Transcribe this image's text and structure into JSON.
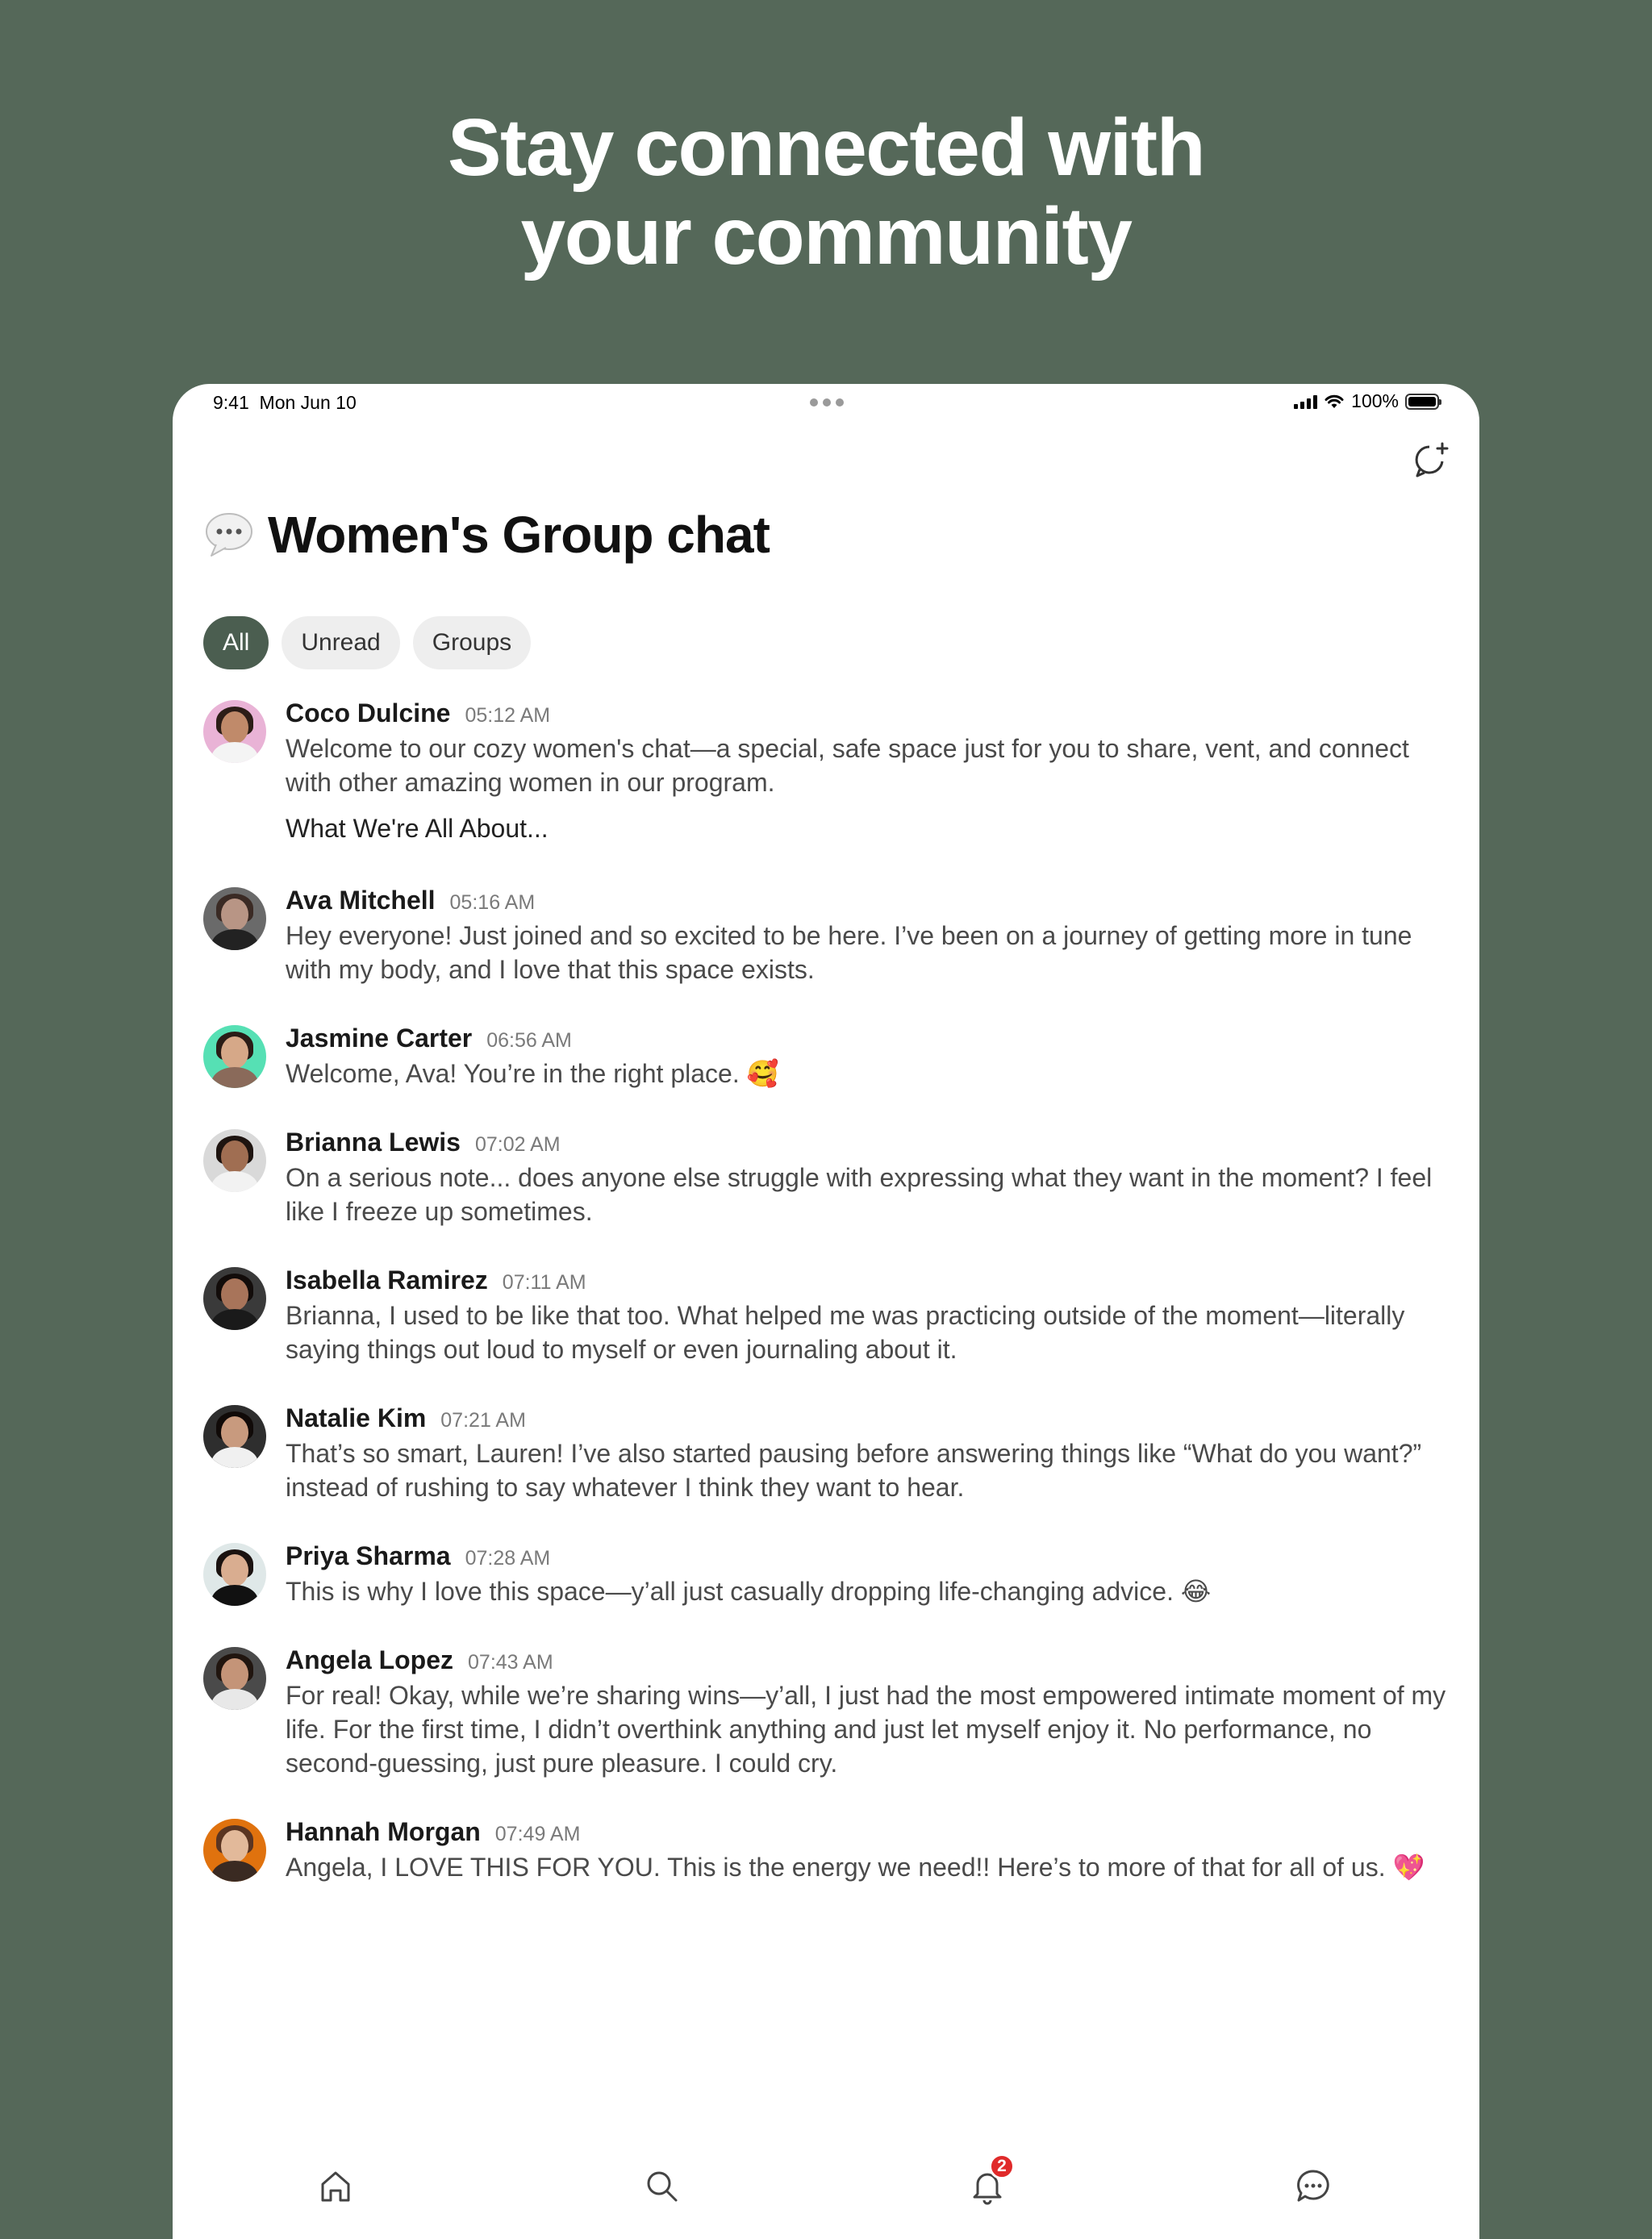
{
  "headline": {
    "line1": "Stay connected with",
    "line2": "your community"
  },
  "status_bar": {
    "time": "9:41",
    "date": "Mon Jun 10",
    "battery": "100%"
  },
  "page": {
    "title": "Women's Group chat",
    "title_icon": "speech-bubble-icon"
  },
  "filters": [
    {
      "label": "All",
      "active": true
    },
    {
      "label": "Unread",
      "active": false
    },
    {
      "label": "Groups",
      "active": false
    }
  ],
  "messages": [
    {
      "name": "Coco Dulcine",
      "time": "05:12 AM",
      "text": "Welcome to our cozy women's chat—a special, safe space just for you to share, vent, and connect with other amazing women in our program.",
      "subtext": "What We're All About..."
    },
    {
      "name": "Ava Mitchell",
      "time": "05:16 AM",
      "text": "Hey everyone! Just joined and so excited to be here. I’ve been on a journey of getting more in tune with my body, and I love that this space exists."
    },
    {
      "name": "Jasmine Carter",
      "time": "06:56 AM",
      "text": "Welcome, Ava! You’re in the right place. 🥰"
    },
    {
      "name": "Brianna Lewis",
      "time": "07:02 AM",
      "text": "On a serious note... does anyone else struggle with expressing what they want in the moment? I feel like I freeze up sometimes."
    },
    {
      "name": "Isabella Ramirez",
      "time": "07:11 AM",
      "text": "Brianna, I used to be like that too. What helped me was practicing outside of the moment—literally saying things out loud to myself or even journaling about it."
    },
    {
      "name": "Natalie Kim",
      "time": "07:21 AM",
      "text": "That’s so smart, Lauren! I’ve also started pausing before answering things like “What do you want?” instead of rushing to say whatever I think they want to hear."
    },
    {
      "name": "Priya Sharma",
      "time": "07:28 AM",
      "text": "This is why I love this space—y’all just casually dropping life-changing advice. 😂"
    },
    {
      "name": "Angela Lopez",
      "time": "07:43 AM",
      "text": "For real! Okay, while we’re sharing wins—y’all, I just had the most empowered intimate moment of my life. For the first time, I didn’t overthink anything and just let myself enjoy it. No performance, no second-guessing, just pure pleasure. I could cry."
    },
    {
      "name": "Hannah Morgan",
      "time": "07:49 AM",
      "text": "Angela, I LOVE THIS FOR YOU. This is the energy we need!! Here’s to more of that for all of us. 💖"
    }
  ],
  "tabbar": {
    "notifications_badge": "2"
  },
  "colors": {
    "background": "#556859",
    "accent": "#4b5e50",
    "badge": "#e02a2a"
  }
}
